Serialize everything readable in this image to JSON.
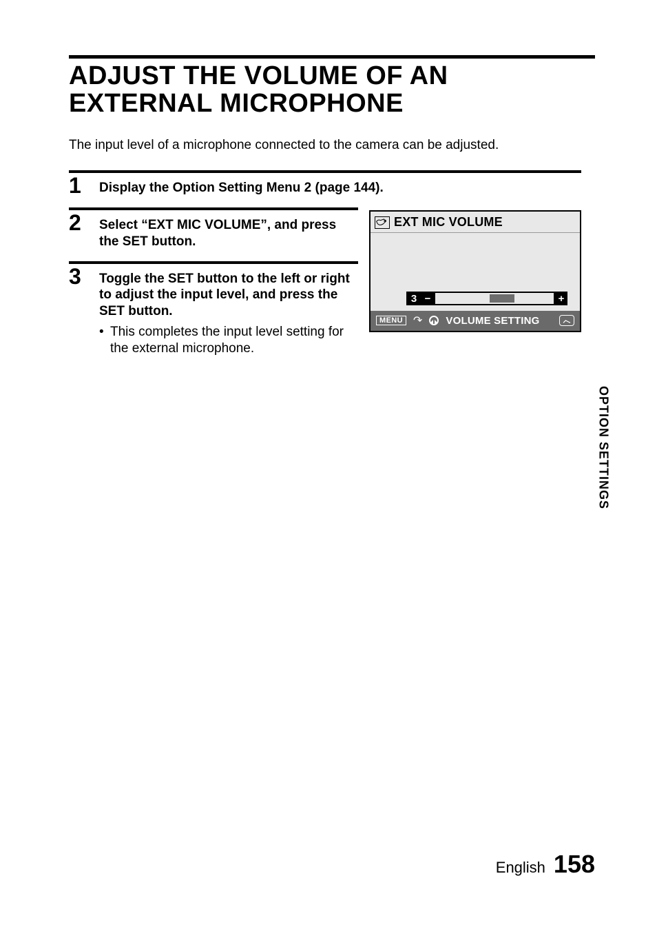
{
  "heading": "ADJUST THE VOLUME OF AN EXTERNAL MICROPHONE",
  "intro": "The input level of a microphone connected to the camera can be adjusted.",
  "steps": {
    "s1": {
      "num": "1",
      "head": "Display the Option Setting Menu 2 (page 144)."
    },
    "s2": {
      "num": "2",
      "head": "Select “EXT MIC VOLUME”, and press the SET button."
    },
    "s3": {
      "num": "3",
      "head": "Toggle the SET button to the left or right to adjust the input level, and press the SET button.",
      "bullet": "•",
      "sub": "This completes the input level setting for the external microphone."
    }
  },
  "screen": {
    "title": "EXT MIC VOLUME",
    "level": "3",
    "minus": "−",
    "plus": "+",
    "menu": "MENU",
    "back": "↶",
    "footer": "VOLUME SETTING",
    "ok": " "
  },
  "sideTab": "OPTION SETTINGS",
  "footer": {
    "lang": "English",
    "page": "158"
  }
}
